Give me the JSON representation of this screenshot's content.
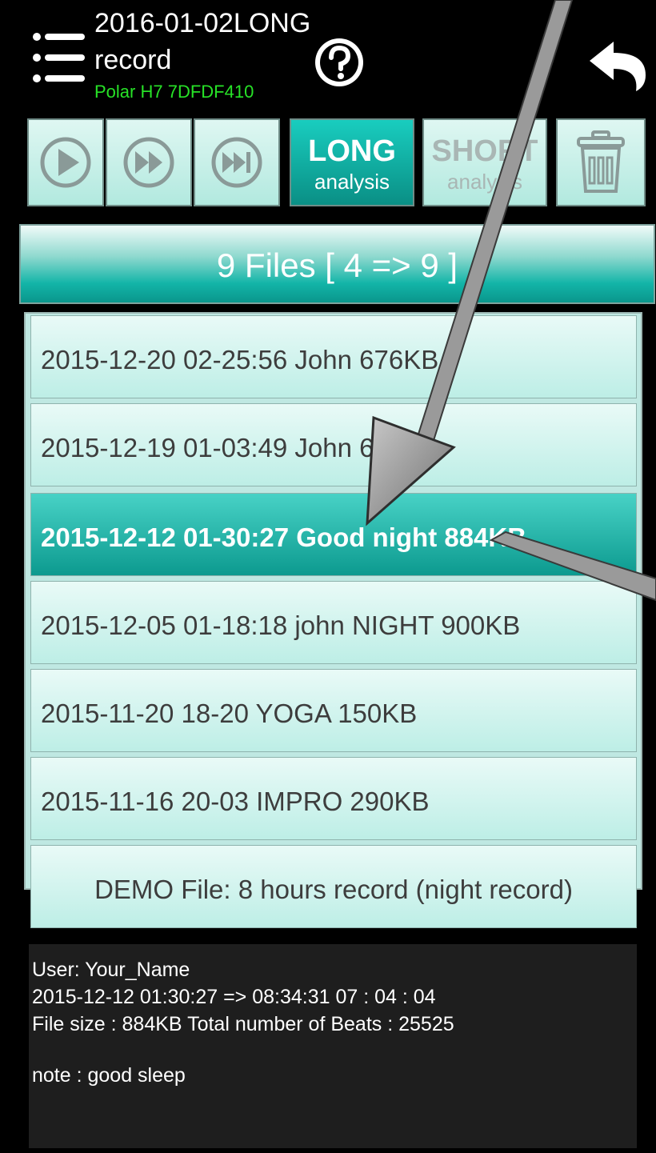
{
  "header": {
    "title_line1": "2016-01-02LONG",
    "title_line2": "record",
    "device": "Polar H7 7DFDF410"
  },
  "toolbar": {
    "long_label": "LONG",
    "long_sub": "analysis",
    "short_label": "SHORT",
    "short_sub": "analysis"
  },
  "files_bar": {
    "text": "9 Files [ 4 => 9 ]"
  },
  "files": [
    {
      "text": "2015-12-20 02-25:56 John  676KB"
    },
    {
      "text": "2015-12-19 01-03:49 John  616KB"
    },
    {
      "text": "2015-12-12 01-30:27 Good night  884KB",
      "selected": true
    },
    {
      "text": "2015-12-05 01-18:18 john NIGHT  900KB"
    },
    {
      "text": "2015-11-20 18-20 YOGA  150KB"
    },
    {
      "text": "2015-11-16 20-03 IMPRO  290KB"
    },
    {
      "text": "DEMO File: 8 hours record (night record)"
    }
  ],
  "info": {
    "user": "User: Your_Name",
    "range": "2015-12-12    01:30:27 => 08:34:31       07 : 04 : 04",
    "size": "File size : 884KB     Total number of Beats : 25525",
    "note": "note : good sleep"
  },
  "colors": {
    "accent": "#12b3a6",
    "device_text": "#27e227",
    "background": "#000000"
  },
  "icons": [
    "menu-icon",
    "help-icon",
    "back-icon",
    "play-icon",
    "fast-forward-icon",
    "skip-end-icon",
    "trash-icon"
  ]
}
